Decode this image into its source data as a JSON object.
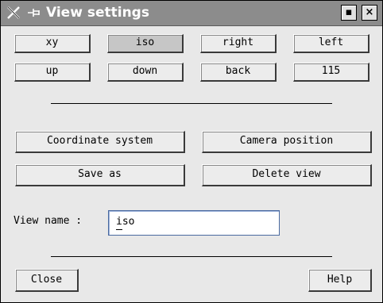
{
  "window": {
    "title": "View settings",
    "controls": {
      "minimize_glyph": "▪",
      "close_glyph": "×"
    },
    "icons": [
      "x-logo-icon",
      "pin-icon"
    ]
  },
  "views": {
    "row1": [
      "xy",
      "iso",
      "right",
      "left"
    ],
    "row2": [
      "up",
      "down",
      "back",
      "115"
    ],
    "selected": "iso"
  },
  "actions": {
    "coordinate_system": "Coordinate system",
    "camera_position": "Camera position",
    "save_as": "Save as",
    "delete_view": "Delete view"
  },
  "view_name": {
    "label": "View name :",
    "value": "iso"
  },
  "footer": {
    "close": "Close",
    "help": "Help"
  },
  "colors": {
    "titlebar": "#8c8c8c",
    "window_bg": "#e8e8e8",
    "selected_button": "#c6c6c6"
  }
}
